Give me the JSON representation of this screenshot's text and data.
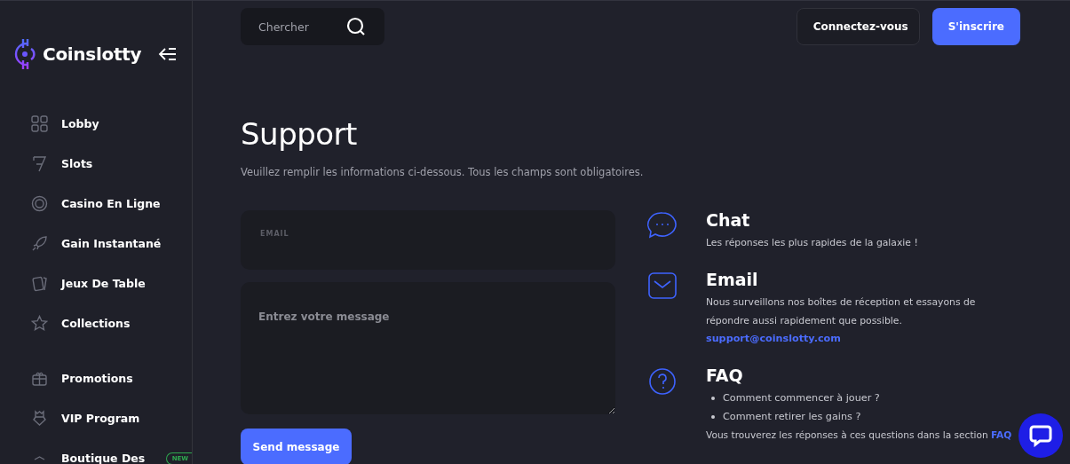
{
  "sidebar": {
    "logo": "Coinslotty",
    "sections": [
      {
        "items": [
          {
            "label": "Lobby"
          },
          {
            "label": "Slots"
          },
          {
            "label": "Casino En Ligne"
          },
          {
            "label": "Gain Instantané"
          },
          {
            "label": "Jeux De Table"
          },
          {
            "label": "Collections"
          }
        ]
      },
      {
        "items": [
          {
            "label": "Promotions"
          },
          {
            "label": "VIP Program"
          },
          {
            "label": "Boutique Des",
            "badge": "NEW"
          }
        ]
      }
    ]
  },
  "header": {
    "search": {
      "placeholder": "Chercher"
    },
    "buttons": [
      {
        "label": "Connectez-vous",
        "kind": "secondary"
      },
      {
        "label": "S'inscrire",
        "kind": "primary"
      }
    ]
  },
  "page": {
    "title": "Support",
    "subtitle": "Veuillez remplir les informations ci-dessous. Tous les champs sont obligatoires.",
    "form": {
      "email_placeholder": "EMAIL",
      "message_placeholder": "Entrez votre message",
      "submit": "Send message"
    },
    "contacts": [
      {
        "kind": "chat",
        "title": "Chat",
        "text": "Les réponses les plus rapides de la galaxie !"
      },
      {
        "kind": "email",
        "title": "Email",
        "text": "Nous surveillons nos boîtes de réception et essayons de répondre aussi rapidement que possible.",
        "link": "support@coinslotty.com"
      },
      {
        "kind": "faq",
        "title": "FAQ",
        "questions": [
          "Comment commencer à jouer ?",
          "Comment retirer les gains ?"
        ],
        "text": "Vous trouverez les réponses à ces questions dans la section ",
        "link": "FAQ"
      }
    ]
  }
}
